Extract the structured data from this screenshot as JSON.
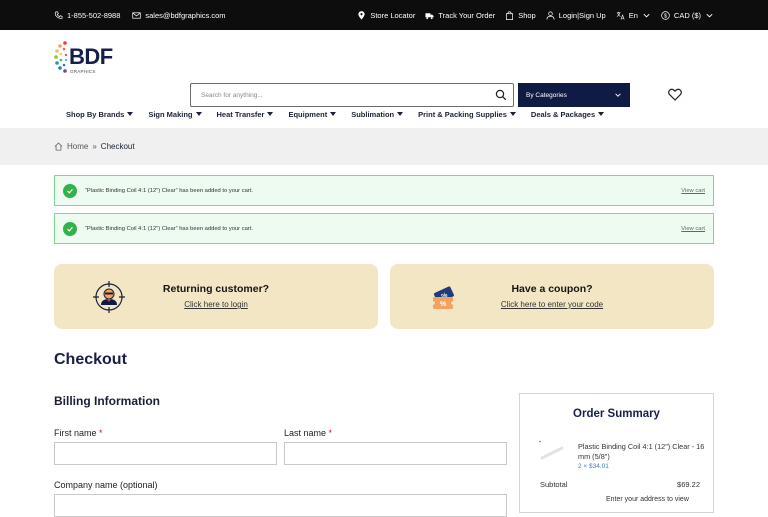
{
  "topbar": {
    "phone": "1-855-502-8988",
    "email": "sales@bdfgraphics.com",
    "store_locator": "Store Locator",
    "track_order": "Track Your Order",
    "shop": "Shop",
    "login": "Login|Sign Up",
    "language": "En",
    "currency": "CAD ($)"
  },
  "brand": {
    "logo_text": "BDF",
    "logo_sub": "GRAPHICS"
  },
  "search": {
    "placeholder": "Search for anything...",
    "categories_label": "By Categories"
  },
  "nav": {
    "items": [
      {
        "label": "Shop By Brands"
      },
      {
        "label": "Sign Making"
      },
      {
        "label": "Heat Transfer"
      },
      {
        "label": "Equipment"
      },
      {
        "label": "Sublimation"
      },
      {
        "label": "Print & Packing Supplies"
      },
      {
        "label": "Deals & Packages"
      }
    ]
  },
  "breadcrumb": {
    "home": "Home",
    "separator": "»",
    "current": "Checkout"
  },
  "notices": [
    {
      "message": "“Plastic Binding Coil 4:1 (12\") Clear” has been added to your cart.",
      "action": "View cart"
    },
    {
      "message": "“Plastic Binding Coil 4:1 (12\") Clear” has been added to your cart.",
      "action": "View cart"
    }
  ],
  "cards": {
    "returning": {
      "title": "Returning customer?",
      "link": "Click here to login"
    },
    "coupon": {
      "title": "Have a coupon?",
      "link": "Click here to enter your code"
    }
  },
  "checkout": {
    "title": "Checkout",
    "billing_title": "Billing Information",
    "first_name_label": "First name",
    "last_name_label": "Last name",
    "required_mark": "*",
    "company_label": "Company name (optional)"
  },
  "summary": {
    "title": "Order Summary",
    "product_name": "Plastic Binding Coil 4:1 (12\") Clear - 16 mm (5/8\")",
    "product_qty": "2 × $34.01",
    "subtotal_label": "Subtotal",
    "subtotal_value": "$69.22",
    "address_note": "Enter your address to view"
  },
  "colors": {
    "topbar_bg": "#0d0d0d",
    "brand_navy": "#0f1b44",
    "notice_border": "#7fd88f",
    "notice_bg": "#eefbf0",
    "success_green": "#33b24c",
    "card_bg": "#f2e6c5",
    "breadcrumb_bg": "#f0f0f0"
  }
}
